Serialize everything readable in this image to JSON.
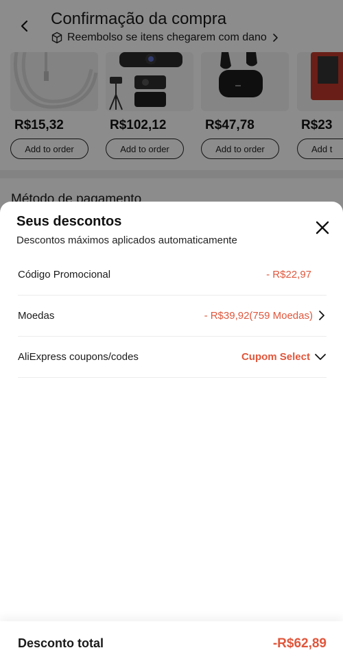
{
  "header": {
    "title": "Confirmação da compra",
    "refund_text": "Reembolso se itens chegarem com dano"
  },
  "products": [
    {
      "price": "R$15,32",
      "button": "Add to order",
      "image": "cable-image"
    },
    {
      "price": "R$102,12",
      "button": "Add to order",
      "image": "webcam-image"
    },
    {
      "price": "R$47,78",
      "button": "Add to order",
      "image": "earbuds-image"
    },
    {
      "price": "R$23",
      "button": "Add t",
      "image": "product-image"
    }
  ],
  "payment": {
    "title": "Método de pagamento"
  },
  "sheet": {
    "title": "Seus descontos",
    "subtitle": "Descontos máximos aplicados automaticamente",
    "rows": [
      {
        "label": "Código Promocional",
        "value": "- R$22,97"
      },
      {
        "label": "Moedas",
        "value": "- R$39,92(759 Moedas)"
      },
      {
        "label": "AliExpress coupons/codes",
        "value": "Cupom Select"
      }
    ]
  },
  "footer": {
    "label": "Desconto total",
    "value": "-R$62,89"
  },
  "colors": {
    "accent": "#e0563b",
    "text": "#1a1a1a",
    "overlay": "rgba(0,0,0,0.45)"
  }
}
